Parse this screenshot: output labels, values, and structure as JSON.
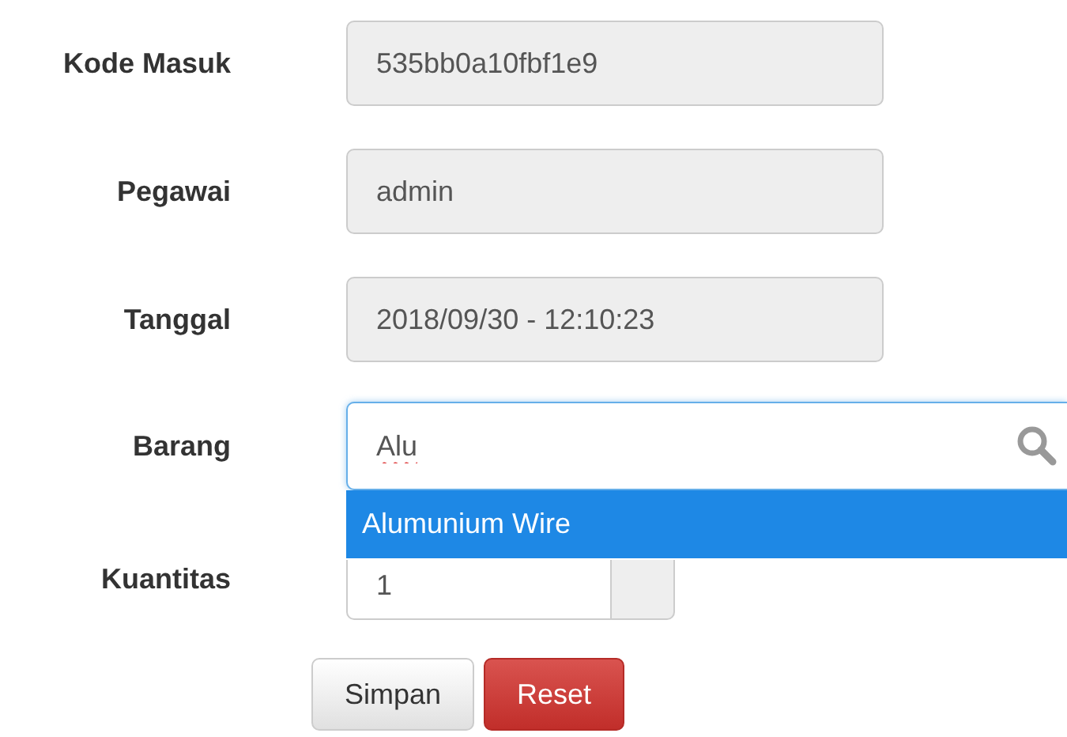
{
  "fields": [
    {
      "label": "Kode Masuk",
      "value": "535bb0a10fbf1e9",
      "readonly": true
    },
    {
      "label": "Pegawai",
      "value": "admin",
      "readonly": true
    },
    {
      "label": "Tanggal",
      "value": "2018/09/30 - 12:10:23",
      "readonly": true
    }
  ],
  "search": {
    "label": "Barang",
    "value": "Alu",
    "suggestions": [
      {
        "text": "Alumunium Wire",
        "selected": true
      }
    ]
  },
  "quantity": {
    "label": "Kuantitas",
    "value": "1"
  },
  "buttons": [
    {
      "label": "Simpan",
      "kind": "default"
    },
    {
      "label": "Reset",
      "kind": "danger"
    }
  ]
}
